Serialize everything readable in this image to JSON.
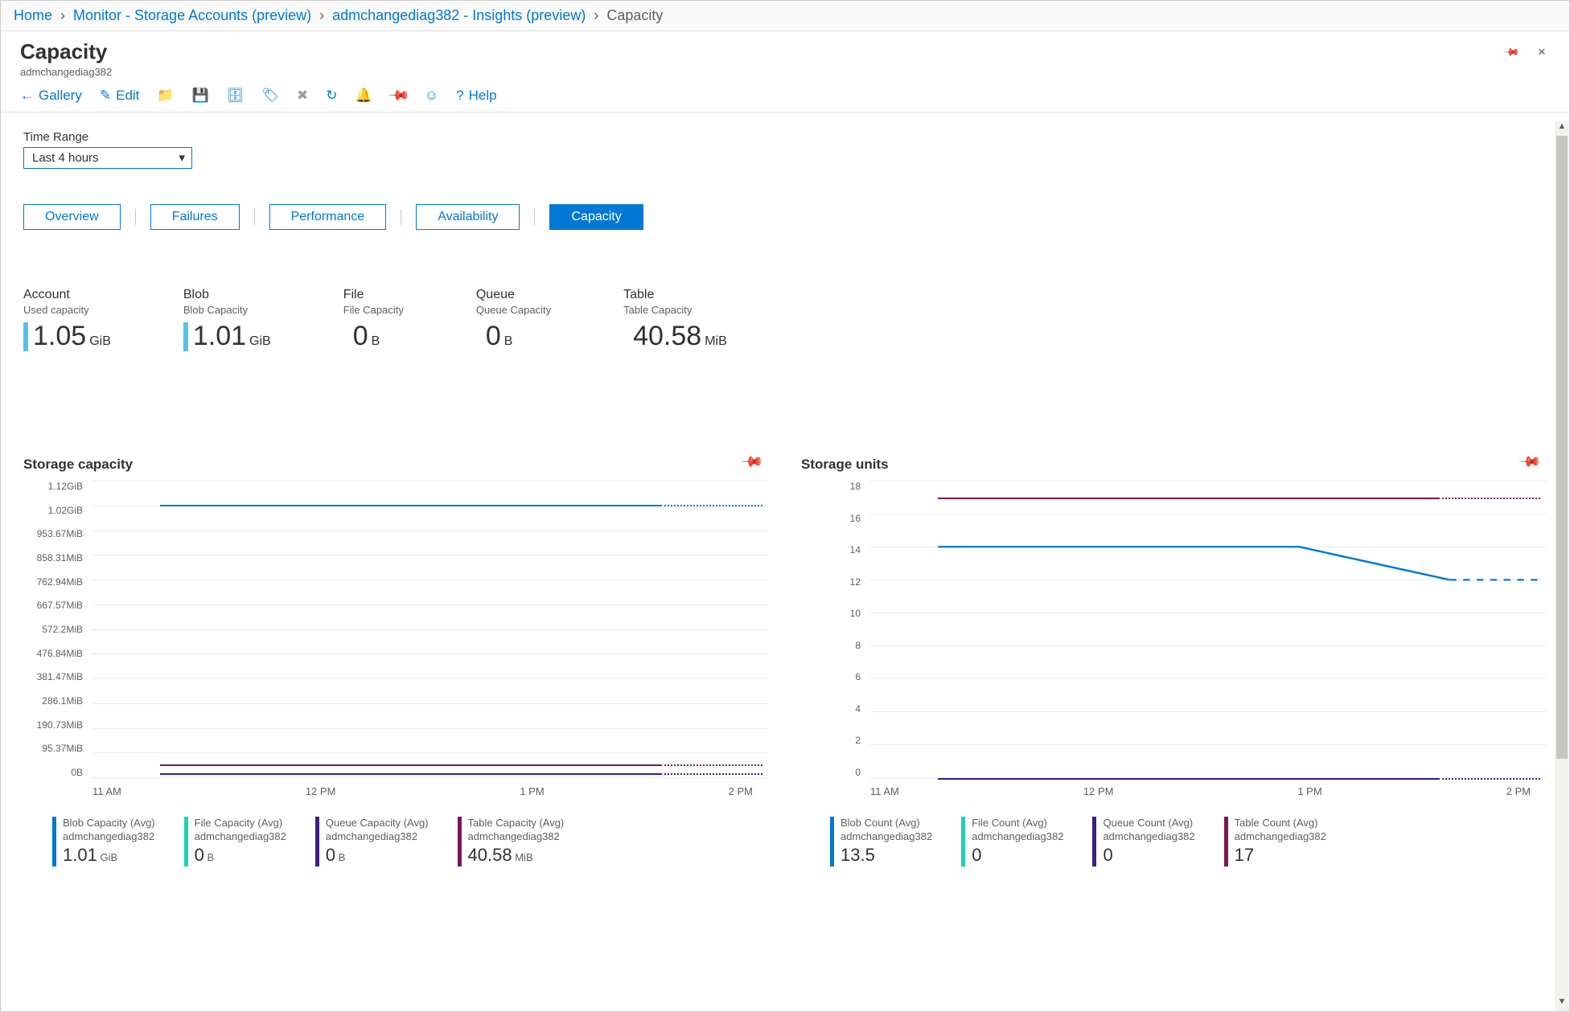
{
  "breadcrumb": {
    "home": "Home",
    "monitor": "Monitor - Storage Accounts (preview)",
    "insights": "admchangediag382 - Insights (preview)",
    "current": "Capacity"
  },
  "header": {
    "title": "Capacity",
    "subtitle": "admchangediag382"
  },
  "toolbar": {
    "gallery": "Gallery",
    "edit": "Edit",
    "help": "Help"
  },
  "time_range": {
    "label": "Time Range",
    "value": "Last 4 hours"
  },
  "tabs": {
    "overview": "Overview",
    "failures": "Failures",
    "performance": "Performance",
    "availability": "Availability",
    "capacity": "Capacity"
  },
  "metrics": {
    "account": {
      "label": "Account",
      "sub": "Used capacity",
      "value": "1.05",
      "unit": "GiB"
    },
    "blob": {
      "label": "Blob",
      "sub": "Blob Capacity",
      "value": "1.01",
      "unit": "GiB"
    },
    "file": {
      "label": "File",
      "sub": "File Capacity",
      "value": "0",
      "unit": "B"
    },
    "queue": {
      "label": "Queue",
      "sub": "Queue Capacity",
      "value": "0",
      "unit": "B"
    },
    "table": {
      "label": "Table",
      "sub": "Table Capacity",
      "value": "40.58",
      "unit": "MiB"
    }
  },
  "chart_data": [
    {
      "type": "line",
      "title": "Storage capacity",
      "x": [
        "11 AM",
        "12 PM",
        "1 PM",
        "2 PM"
      ],
      "y_ticks": [
        "1.12GiB",
        "1.02GiB",
        "953.67MiB",
        "858.31MiB",
        "762.94MiB",
        "667.57MiB",
        "572.2MiB",
        "476.84MiB",
        "381.47MiB",
        "286.1MiB",
        "190.73MiB",
        "95.37MiB",
        "0B"
      ],
      "series": [
        {
          "name": "Blob Capacity (Avg)",
          "account": "admchangediag382",
          "value": "1.01",
          "unit": "GiB",
          "color": "#0078d4",
          "flat_at_frac": 0.08
        },
        {
          "name": "File Capacity (Avg)",
          "account": "admchangediag382",
          "value": "0",
          "unit": "B",
          "color": "#1fd2b3",
          "flat_at_frac": 0.985
        },
        {
          "name": "Queue Capacity (Avg)",
          "account": "admchangediag382",
          "value": "0",
          "unit": "B",
          "color": "#3b1e87",
          "flat_at_frac": 0.985
        },
        {
          "name": "Table Capacity (Avg)",
          "account": "admchangediag382",
          "value": "40.58",
          "unit": "MiB",
          "color": "#7b1659",
          "flat_at_frac": 0.955
        }
      ]
    },
    {
      "type": "line",
      "title": "Storage units",
      "x": [
        "11 AM",
        "12 PM",
        "1 PM",
        "2 PM"
      ],
      "y_ticks": [
        "18",
        "16",
        "14",
        "12",
        "10",
        "8",
        "6",
        "4",
        "2",
        "0"
      ],
      "ylim": [
        0,
        18
      ],
      "series": [
        {
          "name": "Blob Count (Avg)",
          "account": "admchangediag382",
          "value": "13.5",
          "color": "#0078d4",
          "points": [
            [
              0,
              14
            ],
            [
              0.6,
              14
            ],
            [
              0.85,
              12
            ],
            [
              1.0,
              12
            ]
          ]
        },
        {
          "name": "File Count (Avg)",
          "account": "admchangediag382",
          "value": "0",
          "color": "#1fd2b3",
          "flat_at": 0
        },
        {
          "name": "Queue Count (Avg)",
          "account": "admchangediag382",
          "value": "0",
          "color": "#3b1e87",
          "flat_at": 0
        },
        {
          "name": "Table Count (Avg)",
          "account": "admchangediag382",
          "value": "17",
          "color": "#7b1659",
          "flat_at": 17
        }
      ]
    }
  ]
}
